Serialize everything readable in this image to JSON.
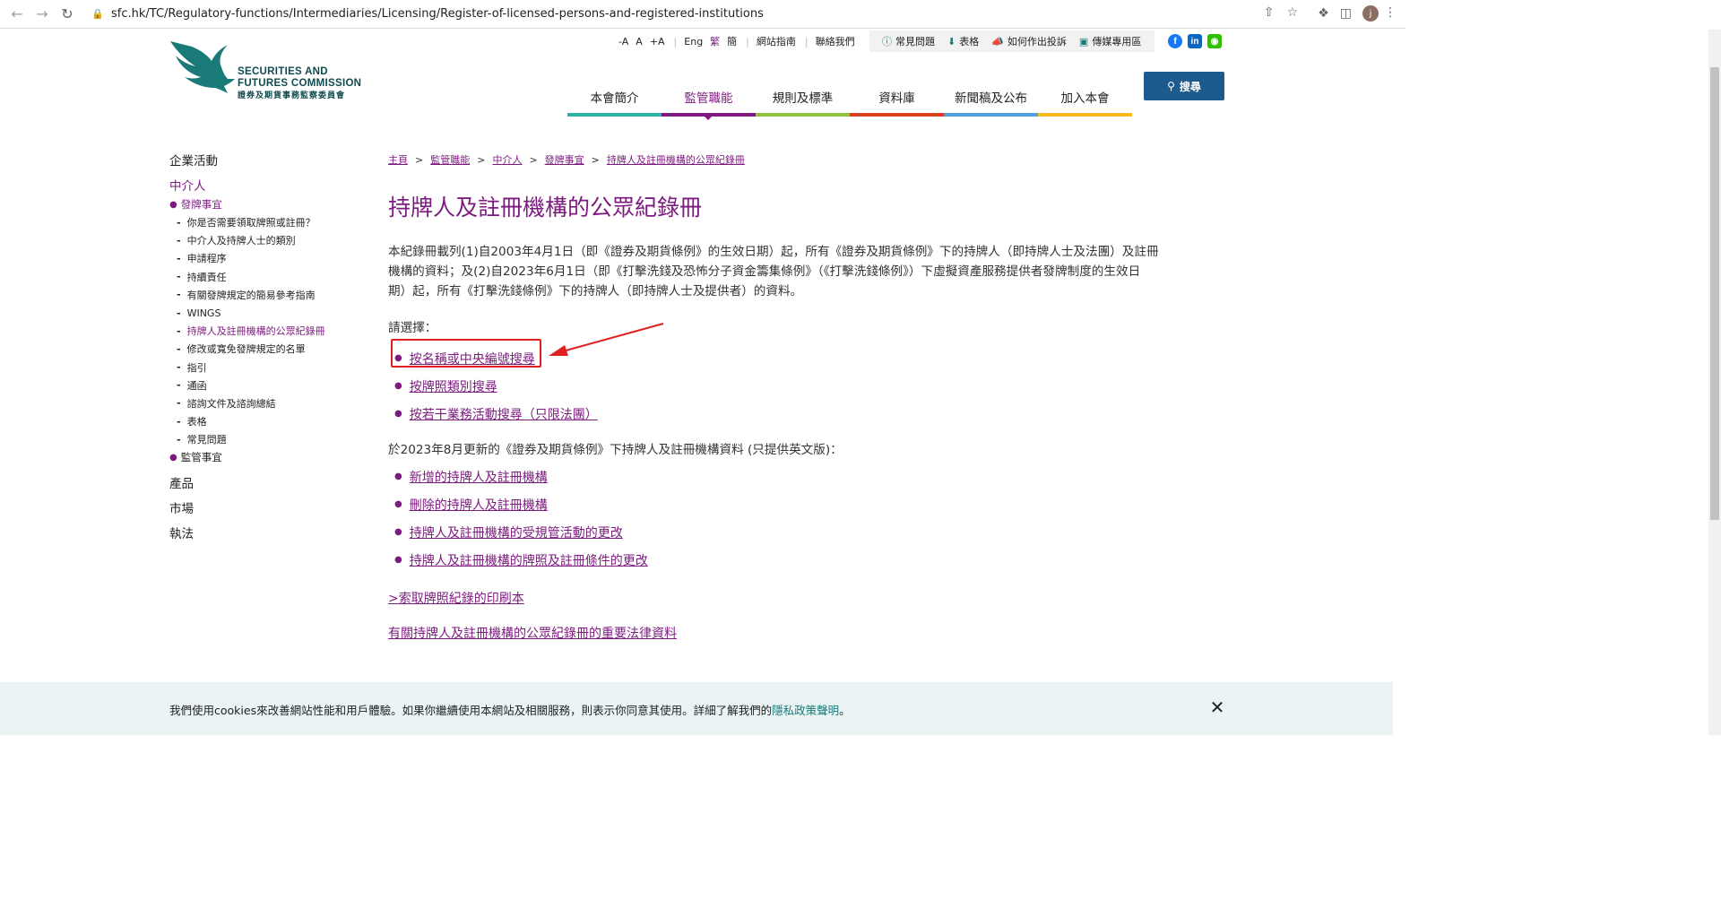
{
  "browser": {
    "url": "sfc.hk/TC/Regulatory-functions/Intermediaries/Licensing/Register-of-licensed-persons-and-registered-institutions",
    "avatar": "j"
  },
  "header": {
    "logo_en_1": "SECURITIES AND",
    "logo_en_2": "FUTURES COMMISSION",
    "logo_zh": "證券及期貨事務監察委員會",
    "font_small": "-A",
    "font_normal": "A",
    "font_large": "+A",
    "lang_en": "Eng",
    "lang_tc": "繁",
    "lang_sc": "簡",
    "sitemap": "網站指南",
    "contact": "聯絡我們",
    "faq": "常見問題",
    "forms": "表格",
    "complaint": "如何作出投訴",
    "media": "傳媒專用區",
    "search": "搜尋"
  },
  "nav": [
    {
      "label": "本會簡介",
      "color": "#2bb2a5"
    },
    {
      "label": "監管職能",
      "color": "#7d1a7f"
    },
    {
      "label": "規則及標準",
      "color": "#8cc63f"
    },
    {
      "label": "資料庫",
      "color": "#d9401e"
    },
    {
      "label": "新聞稿及公布",
      "color": "#4ea3d9"
    },
    {
      "label": "加入本會",
      "color": "#f5b921"
    }
  ],
  "sidebar": {
    "corporate": "企業活動",
    "intermediaries": "中介人",
    "licensing": "發牌事宜",
    "licensing_items": [
      "你是否需要領取牌照或註冊？",
      "中介人及持牌人士的類別",
      "申請程序",
      "持續責任",
      "有關發牌規定的簡易參考指南",
      "WINGS",
      "持牌人及註冊機構的公眾紀錄冊",
      "修改或寬免發牌規定的名單",
      "指引",
      "通函",
      "諮詢文件及諮詢總結",
      "表格",
      "常見問題"
    ],
    "supervision": "監管事宜",
    "products": "產品",
    "markets": "市場",
    "enforcement": "執法"
  },
  "breadcrumb": [
    "主頁",
    "監管職能",
    "中介人",
    "發牌事宜",
    "持牌人及註冊機構的公眾紀錄冊"
  ],
  "main": {
    "title": "持牌人及註冊機構的公眾紀錄冊",
    "intro_1": "本紀錄冊載列(1)自2003年4月1日（即《證券及期貨條例》的生效日期）起，所有《證券及期貨條例》下的持牌人（即持牌人士及法團）及註冊",
    "intro_2": "機構的資料；及(2)自2023年6月1日（即《打擊洗錢及恐怖分子資金籌集條例》（《打擊洗錢條例》）下虛擬資產服務提供者發牌制度的生效日",
    "intro_3": "期）起，所有《打擊洗錢條例》下的持牌人（即持牌人士及提供者）的資料。",
    "choose": "請選擇：",
    "search_links": [
      "按名稱或中央編號搜尋",
      "按牌照類別搜尋",
      "按若干業務活動搜尋（只限法團）"
    ],
    "update_note": "於2023年8月更新的《證券及期貨條例》下持牌人及註冊機構資料 (只提供英文版)：",
    "update_links": [
      "新增的持牌人及註冊機構",
      "刪除的持牌人及註冊機構",
      "持牌人及註冊機構的受規管活動的更改",
      "持牌人及註冊機構的牌照及註冊條件的更改"
    ],
    "print_copy": ">索取牌照紀錄的印刷本",
    "legal_info": "有關持牌人及註冊機構的公眾紀錄冊的重要法律資料"
  },
  "cookie": {
    "text": "我們使用cookies來改善網站性能和用戶體驗。如果你繼續使用本網站及相關服務，則表示你同意其使用。詳細了解我們的",
    "policy_link": "隱私政策聲明",
    "end": "。"
  }
}
